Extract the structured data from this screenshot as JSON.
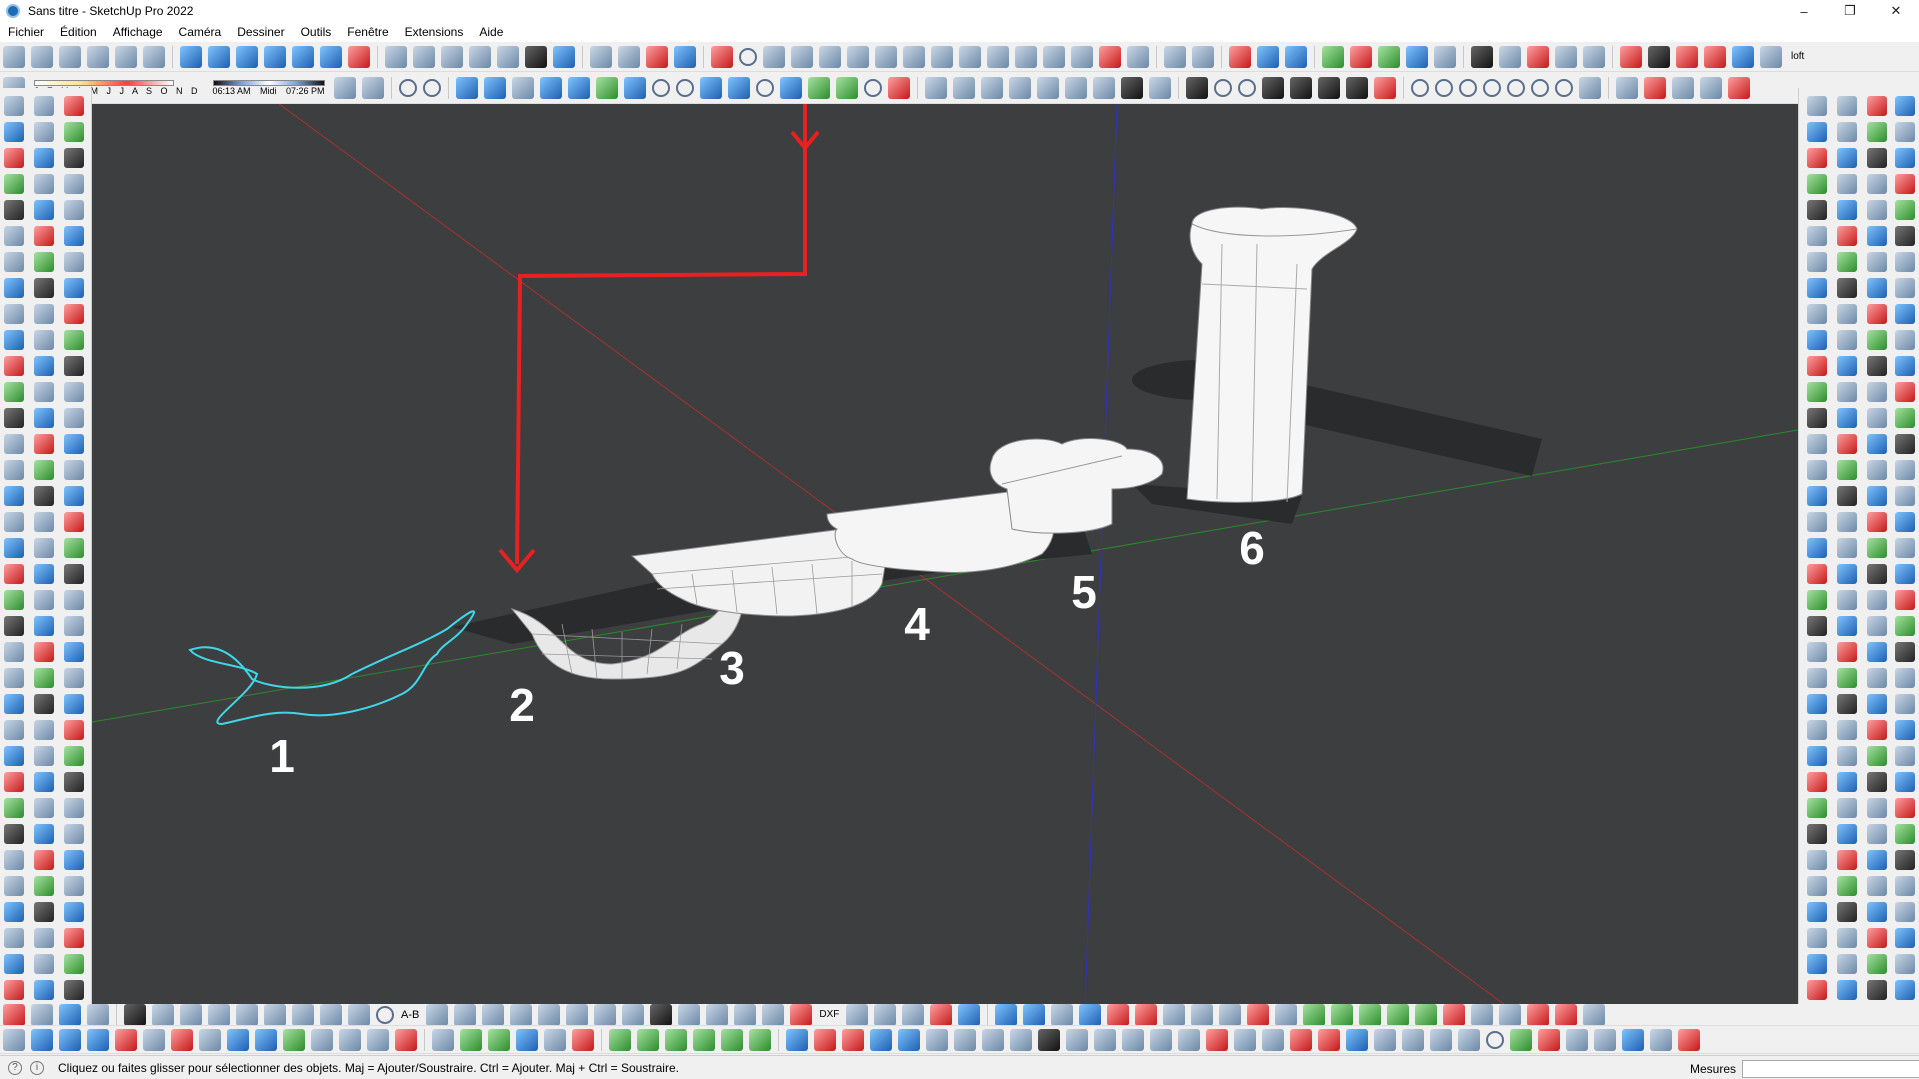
{
  "window": {
    "title": "Sans titre - SketchUp Pro 2022",
    "minimize": "–",
    "maximize": "❐",
    "close": "✕"
  },
  "menu": [
    "Fichier",
    "Édition",
    "Affichage",
    "Caméra",
    "Dessiner",
    "Outils",
    "Fenêtre",
    "Extensions",
    "Aide"
  ],
  "shadow_settings": {
    "months": "J F M A M J J A S O N D",
    "time_start": "06:13 AM",
    "time_mid": "Midi",
    "time_end": "07:26 PM"
  },
  "toolbar_extra_label": "loft",
  "dxf_label": "DXF",
  "ab_label": "A-B",
  "viewport": {
    "background": "#3d3e40",
    "steps": [
      "1",
      "2",
      "3",
      "4",
      "5",
      "6"
    ],
    "curve_color": "#3fd7e8",
    "arrow_color": "#e82020",
    "axis_red": "#c0302a",
    "axis_green": "#2a8a2a",
    "axis_blue": "#3030c8"
  },
  "status": {
    "message": "Cliquez ou faites glisser pour sélectionner des objets. Maj = Ajouter/Soustraire. Ctrl = Ajouter. Maj + Ctrl = Soustraire.",
    "measures_label": "Mesures",
    "measures_value": ""
  }
}
